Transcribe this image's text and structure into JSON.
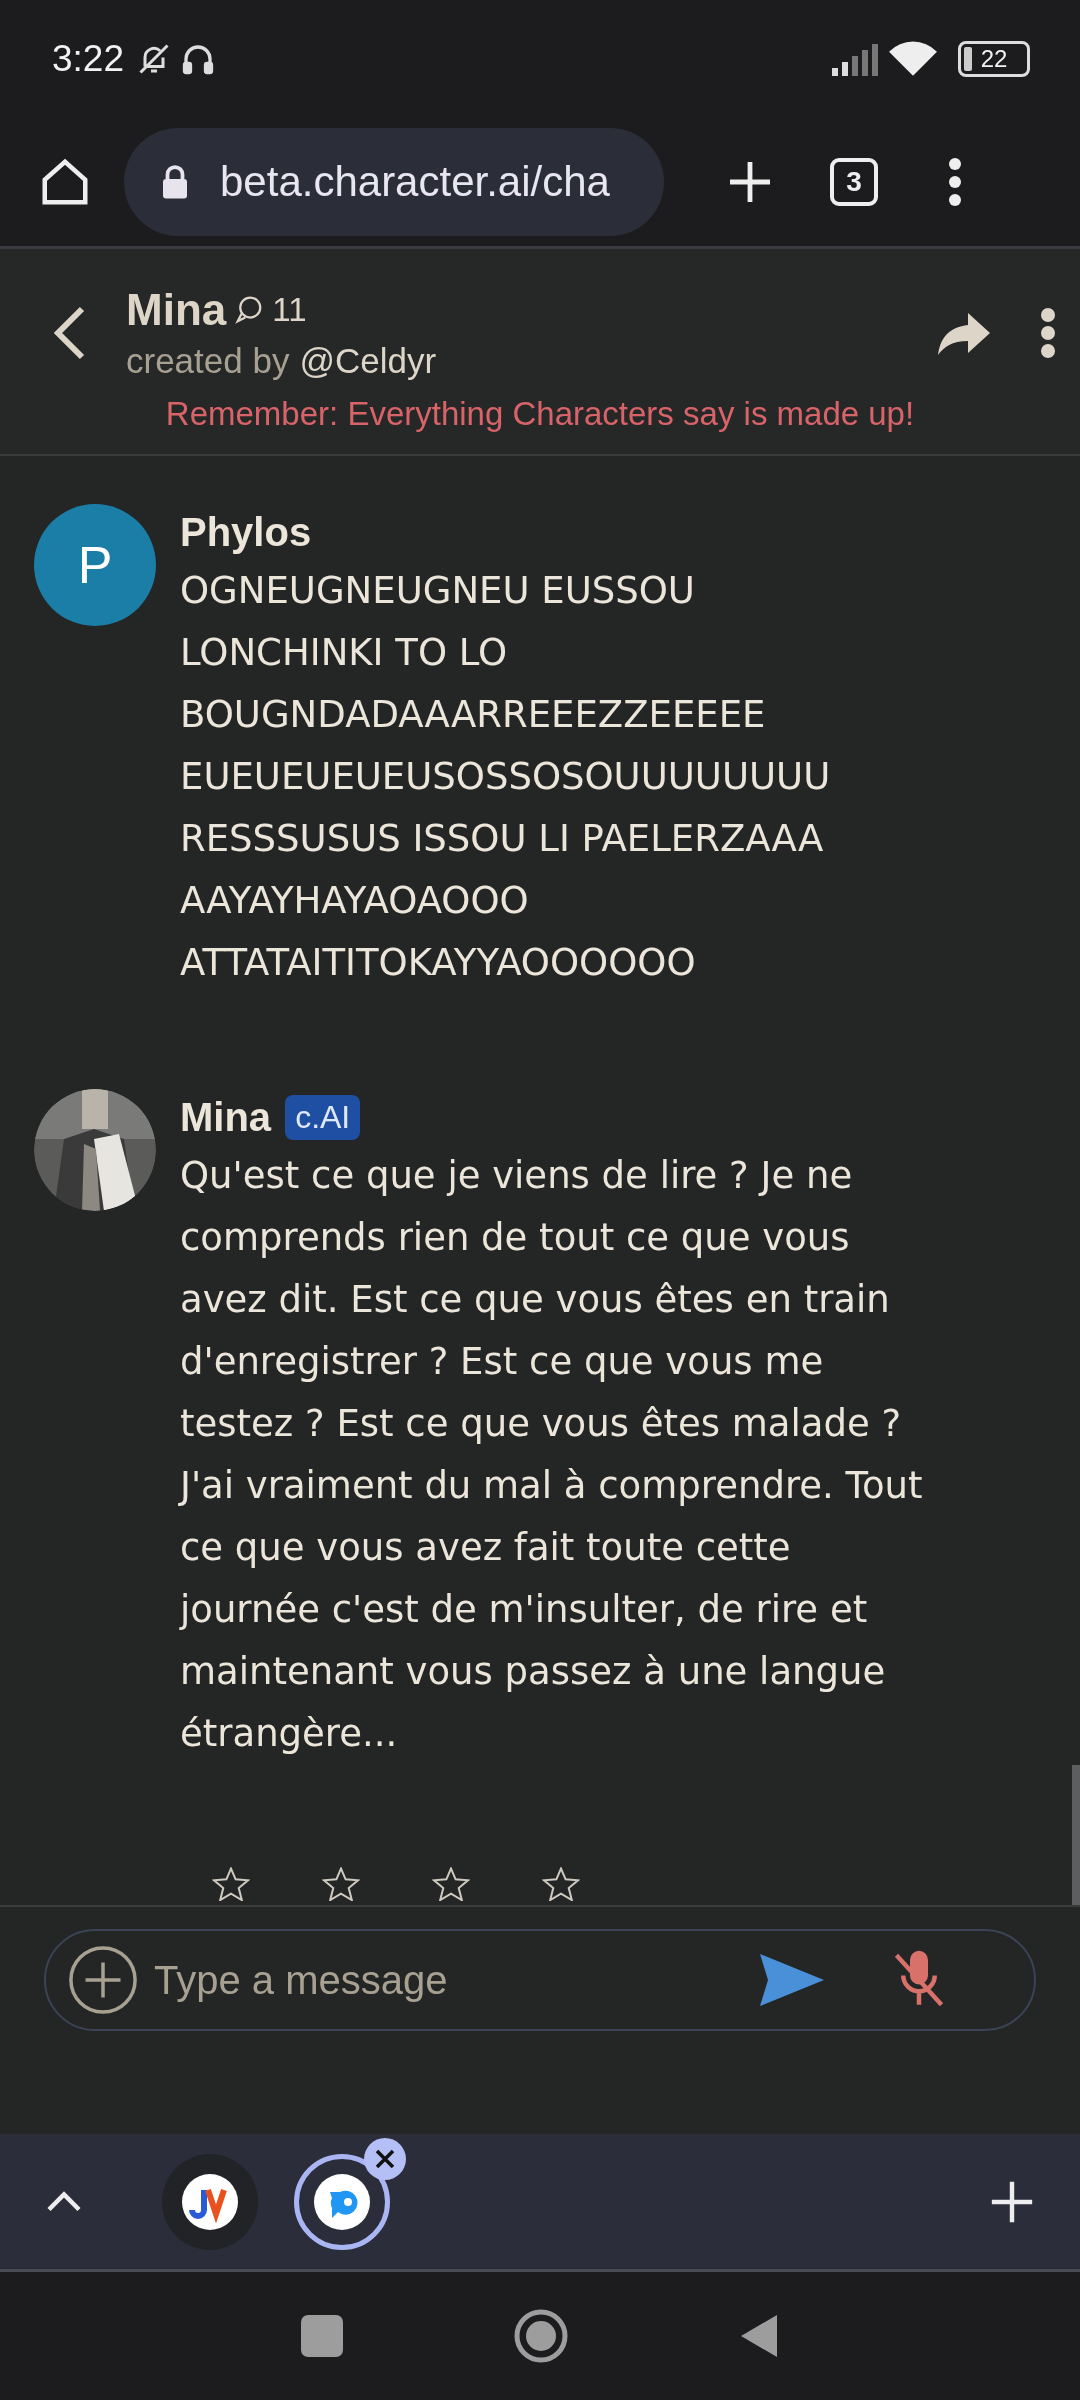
{
  "status_bar": {
    "time": "3:22",
    "battery": "22"
  },
  "browser": {
    "url": "beta.character.ai/cha",
    "tab_count": "3"
  },
  "chat_header": {
    "name": "Mina",
    "chat_count": "11",
    "creator_prefix": "created by",
    "creator": "@Celdyr",
    "disclaimer": "Remember: Everything Characters say is made up!"
  },
  "messages": [
    {
      "author": "Phylos",
      "avatar": {
        "kind": "letter",
        "letter": "P",
        "color": "#1b7ea6"
      },
      "text": "OGNEUGNEUGNEU EUSSOU\nLONCHINKI TO LO\nBOUGNDADAAARREEEZZEEEEE\nEUEUEUEUEUSOSSOSOUUUUUUUU\nRESSSUSUS ISSOU LI PAELERZAAA\nAAYAYHAYAOAOOO\nATTATAITITOKAYYAOOOOOO"
    },
    {
      "author": "Mina",
      "badge": "c.AI",
      "text": "Qu'est ce que je viens de lire ? Je ne comprends rien de tout ce que vous avez dit. Est ce que vous êtes en train d'enregistrer ? Est ce que vous me testez ? Est ce que vous êtes malade ? J'ai vraiment du mal à comprendre. Tout ce que vous avez fait toute cette journée c'est de m'insulter, de rire et maintenant vous passez à une langue étrangère..."
    }
  ],
  "rating": {
    "stars": 0
  },
  "composer": {
    "placeholder": "Type a message"
  },
  "tab_strip": [
    {
      "kind": "jv",
      "selected": false
    },
    {
      "kind": "bot",
      "selected": true
    }
  ]
}
